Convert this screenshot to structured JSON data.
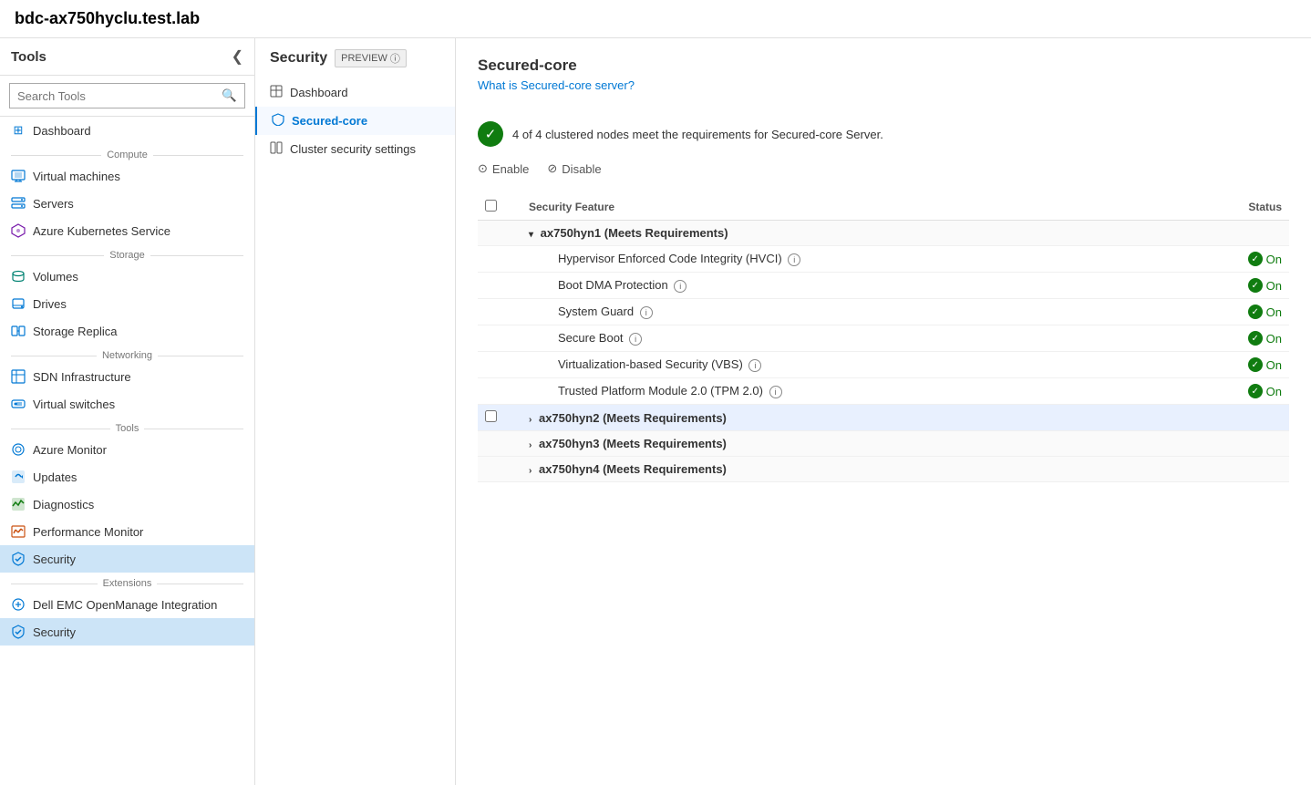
{
  "app": {
    "title": "bdc-ax750hyclu.test.lab"
  },
  "sidebar": {
    "header": "Tools",
    "search_placeholder": "Search Tools",
    "collapse_icon": "❮",
    "groups": [
      {
        "label": "",
        "items": [
          {
            "id": "dashboard",
            "label": "Dashboard",
            "icon": "⊞",
            "icon_class": "icon-blue"
          }
        ]
      },
      {
        "label": "Compute",
        "items": [
          {
            "id": "virtual-machines",
            "label": "Virtual machines",
            "icon": "▣",
            "icon_class": "icon-blue"
          },
          {
            "id": "servers",
            "label": "Servers",
            "icon": "▤",
            "icon_class": "icon-blue"
          },
          {
            "id": "azure-kubernetes",
            "label": "Azure Kubernetes Service",
            "icon": "⬡",
            "icon_class": "icon-purple"
          }
        ]
      },
      {
        "label": "Storage",
        "items": [
          {
            "id": "volumes",
            "label": "Volumes",
            "icon": "⬡",
            "icon_class": "icon-blue"
          },
          {
            "id": "drives",
            "label": "Drives",
            "icon": "⬡",
            "icon_class": "icon-blue"
          },
          {
            "id": "storage-replica",
            "label": "Storage Replica",
            "icon": "▦",
            "icon_class": "icon-blue"
          }
        ]
      },
      {
        "label": "Networking",
        "items": [
          {
            "id": "sdn-infrastructure",
            "label": "SDN Infrastructure",
            "icon": "⊞",
            "icon_class": "icon-blue"
          },
          {
            "id": "virtual-switches",
            "label": "Virtual switches",
            "icon": "▦",
            "icon_class": "icon-blue"
          }
        ]
      },
      {
        "label": "Tools",
        "items": [
          {
            "id": "azure-monitor",
            "label": "Azure Monitor",
            "icon": "◎",
            "icon_class": "icon-blue"
          },
          {
            "id": "updates",
            "label": "Updates",
            "icon": "⊞",
            "icon_class": "icon-blue"
          },
          {
            "id": "diagnostics",
            "label": "Diagnostics",
            "icon": "⬟",
            "icon_class": "icon-green"
          },
          {
            "id": "performance-monitor",
            "label": "Performance Monitor",
            "icon": "⬡",
            "icon_class": "icon-orange"
          },
          {
            "id": "security",
            "label": "Security",
            "icon": "◎",
            "icon_class": "icon-azure",
            "active": true
          }
        ]
      },
      {
        "label": "Extensions",
        "items": [
          {
            "id": "dell-emc",
            "label": "Dell EMC OpenManage Integration",
            "icon": "◉",
            "icon_class": "icon-blue"
          },
          {
            "id": "security2",
            "label": "Security",
            "icon": "◎",
            "icon_class": "icon-azure",
            "active": false
          }
        ]
      }
    ]
  },
  "secondary_nav": {
    "title": "Security",
    "preview_label": "PREVIEW",
    "info_icon": "ⓘ",
    "items": [
      {
        "id": "dashboard",
        "label": "Dashboard",
        "icon": "⊞",
        "active": false
      },
      {
        "id": "secured-core",
        "label": "Secured-core",
        "icon": "🔒",
        "active": true
      },
      {
        "id": "cluster-security",
        "label": "Cluster security settings",
        "icon": "▦",
        "active": false
      }
    ]
  },
  "main": {
    "title": "Secured-core",
    "link_text": "What is Secured-core server?",
    "status_message": "4 of 4 clustered nodes meet the requirements for Secured-core Server.",
    "actions": [
      {
        "id": "enable",
        "label": "Enable",
        "icon": "⊙"
      },
      {
        "id": "disable",
        "label": "Disable",
        "icon": "⊘"
      }
    ],
    "table": {
      "columns": [
        {
          "id": "checkbox",
          "label": ""
        },
        {
          "id": "feature",
          "label": "Security Feature"
        },
        {
          "id": "status",
          "label": "Status"
        }
      ],
      "nodes": [
        {
          "id": "ax750hyn1",
          "label": "ax750hyn1 (Meets Requirements)",
          "expanded": true,
          "highlighted": false,
          "features": [
            {
              "name": "Hypervisor Enforced Code Integrity (HVCI)",
              "has_info": true,
              "status": "On"
            },
            {
              "name": "Boot DMA Protection",
              "has_info": true,
              "status": "On"
            },
            {
              "name": "System Guard",
              "has_info": true,
              "status": "On"
            },
            {
              "name": "Secure Boot",
              "has_info": true,
              "status": "On"
            },
            {
              "name": "Virtualization-based Security (VBS)",
              "has_info": true,
              "status": "On"
            },
            {
              "name": "Trusted Platform Module 2.0 (TPM 2.0)",
              "has_info": true,
              "status": "On"
            }
          ]
        },
        {
          "id": "ax750hyn2",
          "label": "ax750hyn2 (Meets Requirements)",
          "expanded": false,
          "highlighted": true,
          "features": []
        },
        {
          "id": "ax750hyn3",
          "label": "ax750hyn3 (Meets Requirements)",
          "expanded": false,
          "highlighted": false,
          "features": []
        },
        {
          "id": "ax750hyn4",
          "label": "ax750hyn4 (Meets Requirements)",
          "expanded": false,
          "highlighted": false,
          "features": []
        }
      ]
    }
  }
}
